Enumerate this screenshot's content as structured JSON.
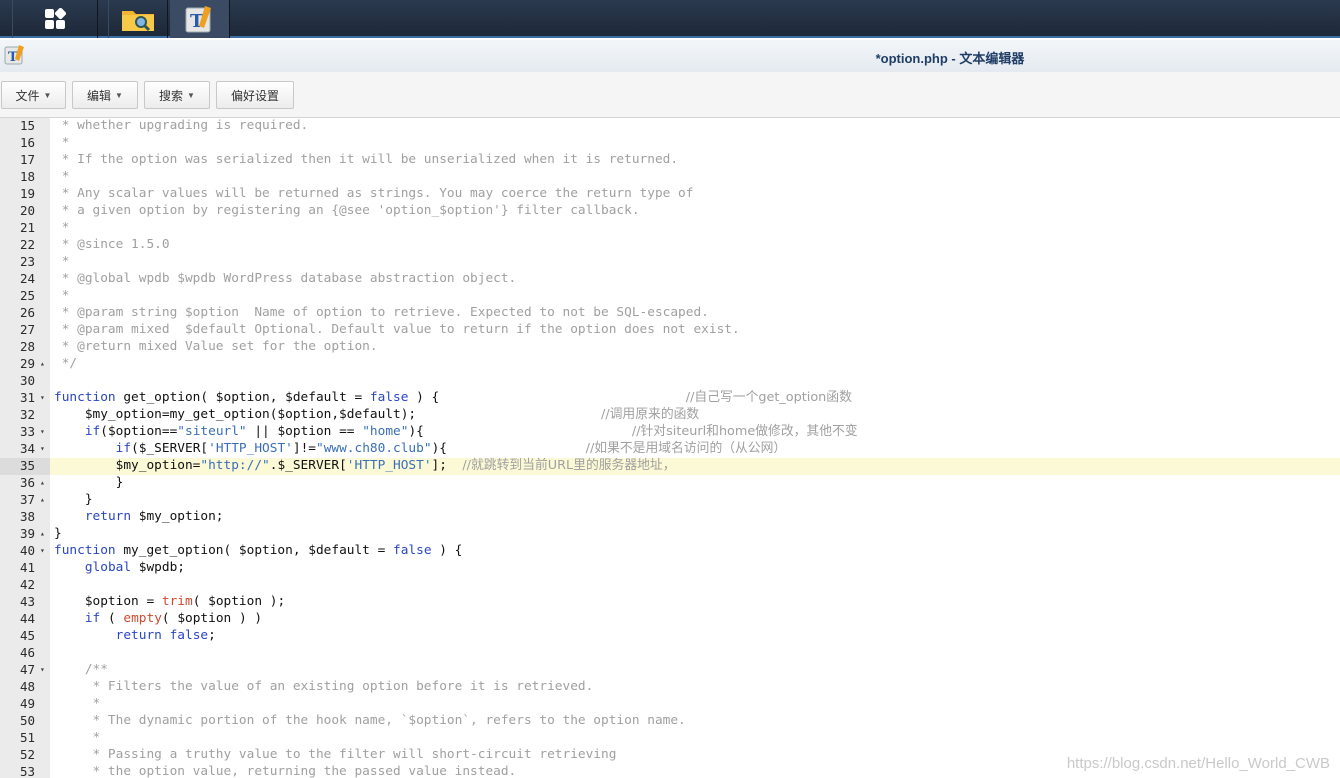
{
  "window": {
    "title": "*option.php - 文本编辑器"
  },
  "taskbar": {
    "icons": [
      "apps-grid-icon",
      "file-station-icon",
      "text-editor-icon"
    ]
  },
  "menu": {
    "file": "文件",
    "edit": "编辑",
    "search": "搜索",
    "preferences": "偏好设置"
  },
  "watermark": "https://blog.csdn.net/Hello_World_CWB",
  "colors": {
    "comment": "#a0a0a0",
    "keyword": "#2a46c4",
    "string": "#3a6fb8",
    "builtin": "#d1492f",
    "active_line": "#fbf9d6"
  },
  "editor": {
    "active_line": 35,
    "lines": [
      {
        "n": "15",
        "f": "",
        "tokens": [
          [
            " * whether upgrading is required.",
            "c"
          ]
        ]
      },
      {
        "n": "16",
        "f": "",
        "tokens": [
          [
            " *",
            "c"
          ]
        ]
      },
      {
        "n": "17",
        "f": "",
        "tokens": [
          [
            " * If the option was serialized then it will be unserialized when it is returned.",
            "c"
          ]
        ]
      },
      {
        "n": "18",
        "f": "",
        "tokens": [
          [
            " *",
            "c"
          ]
        ]
      },
      {
        "n": "19",
        "f": "",
        "tokens": [
          [
            " * Any scalar values will be returned as strings. You may coerce the return type of",
            "c"
          ]
        ]
      },
      {
        "n": "20",
        "f": "",
        "tokens": [
          [
            " * a given option by registering an {@see 'option_$option'} filter callback.",
            "c"
          ]
        ]
      },
      {
        "n": "21",
        "f": "",
        "tokens": [
          [
            " *",
            "c"
          ]
        ]
      },
      {
        "n": "22",
        "f": "",
        "tokens": [
          [
            " * @since 1.5.0",
            "c"
          ]
        ]
      },
      {
        "n": "23",
        "f": "",
        "tokens": [
          [
            " *",
            "c"
          ]
        ]
      },
      {
        "n": "24",
        "f": "",
        "tokens": [
          [
            " * @global wpdb $wpdb WordPress database abstraction object.",
            "c"
          ]
        ]
      },
      {
        "n": "25",
        "f": "",
        "tokens": [
          [
            " *",
            "c"
          ]
        ]
      },
      {
        "n": "26",
        "f": "",
        "tokens": [
          [
            " * @param string $option  Name of option to retrieve. Expected to not be SQL-escaped.",
            "c"
          ]
        ]
      },
      {
        "n": "27",
        "f": "",
        "tokens": [
          [
            " * @param mixed  $default Optional. Default value to return if the option does not exist.",
            "c"
          ]
        ]
      },
      {
        "n": "28",
        "f": "",
        "tokens": [
          [
            " * @return mixed Value set for the option.",
            "c"
          ]
        ]
      },
      {
        "n": "29",
        "f": "▴",
        "tokens": [
          [
            " */",
            "c"
          ]
        ]
      },
      {
        "n": "30",
        "f": "",
        "tokens": []
      },
      {
        "n": "31",
        "f": "▾",
        "tokens": [
          [
            "function",
            "k"
          ],
          [
            " get_option( $option, $default = ",
            "p"
          ],
          [
            "false",
            "k"
          ],
          [
            " ) {                                ",
            "p"
          ],
          [
            "//自己写一个get_option函数",
            "cz"
          ]
        ]
      },
      {
        "n": "32",
        "f": "",
        "tokens": [
          [
            "    $my_option=my_get_option($option,$default);                        ",
            "p"
          ],
          [
            "//调用原来的函数",
            "cz"
          ]
        ]
      },
      {
        "n": "33",
        "f": "▾",
        "tokens": [
          [
            "    ",
            "p"
          ],
          [
            "if",
            "k"
          ],
          [
            "($option==",
            "p"
          ],
          [
            "\"siteurl\"",
            "s"
          ],
          [
            " || $option == ",
            "p"
          ],
          [
            "\"home\"",
            "s"
          ],
          [
            "){                           ",
            "p"
          ],
          [
            "//针对siteurl和home做修改，其他不变",
            "cz"
          ]
        ]
      },
      {
        "n": "34",
        "f": "▾",
        "tokens": [
          [
            "        ",
            "p"
          ],
          [
            "if",
            "k"
          ],
          [
            "($_SERVER[",
            "p"
          ],
          [
            "'HTTP_HOST'",
            "s"
          ],
          [
            "]!=",
            "p"
          ],
          [
            "\"www.ch80.club\"",
            "s"
          ],
          [
            "){                  ",
            "p"
          ],
          [
            "//如果不是用域名访问的（从公网）",
            "cz"
          ]
        ]
      },
      {
        "n": "35",
        "f": "",
        "tokens": [
          [
            "        $my_option=",
            "p"
          ],
          [
            "\"http://\"",
            "s"
          ],
          [
            ".$_SERVER[",
            "p"
          ],
          [
            "'HTTP_HOST'",
            "s"
          ],
          [
            "];  ",
            "p"
          ],
          [
            "//就跳转到当前URL里的服务器地址，",
            "cz"
          ]
        ]
      },
      {
        "n": "36",
        "f": "▴",
        "tokens": [
          [
            "        }",
            "p"
          ]
        ]
      },
      {
        "n": "37",
        "f": "▴",
        "tokens": [
          [
            "    }",
            "p"
          ]
        ]
      },
      {
        "n": "38",
        "f": "",
        "tokens": [
          [
            "    ",
            "p"
          ],
          [
            "return",
            "k"
          ],
          [
            " $my_option;",
            "p"
          ]
        ]
      },
      {
        "n": "39",
        "f": "▴",
        "tokens": [
          [
            "}",
            "p"
          ]
        ]
      },
      {
        "n": "40",
        "f": "▾",
        "tokens": [
          [
            "function",
            "k"
          ],
          [
            " my_get_option( $option, $default = ",
            "p"
          ],
          [
            "false",
            "k"
          ],
          [
            " ) {",
            "p"
          ]
        ]
      },
      {
        "n": "41",
        "f": "",
        "tokens": [
          [
            "    ",
            "p"
          ],
          [
            "global",
            "k"
          ],
          [
            " $wpdb;",
            "p"
          ]
        ]
      },
      {
        "n": "42",
        "f": "",
        "tokens": []
      },
      {
        "n": "43",
        "f": "",
        "tokens": [
          [
            "    $option = ",
            "p"
          ],
          [
            "trim",
            "b"
          ],
          [
            "( $option );",
            "p"
          ]
        ]
      },
      {
        "n": "44",
        "f": "",
        "tokens": [
          [
            "    ",
            "p"
          ],
          [
            "if",
            "k"
          ],
          [
            " ( ",
            "p"
          ],
          [
            "empty",
            "b"
          ],
          [
            "( $option ) )",
            "p"
          ]
        ]
      },
      {
        "n": "45",
        "f": "",
        "tokens": [
          [
            "        ",
            "p"
          ],
          [
            "return",
            "k"
          ],
          [
            " ",
            "p"
          ],
          [
            "false",
            "k"
          ],
          [
            ";",
            "p"
          ]
        ]
      },
      {
        "n": "46",
        "f": "",
        "tokens": []
      },
      {
        "n": "47",
        "f": "▾",
        "tokens": [
          [
            "    /**",
            "c"
          ]
        ]
      },
      {
        "n": "48",
        "f": "",
        "tokens": [
          [
            "     * Filters the value of an existing option before it is retrieved.",
            "c"
          ]
        ]
      },
      {
        "n": "49",
        "f": "",
        "tokens": [
          [
            "     *",
            "c"
          ]
        ]
      },
      {
        "n": "50",
        "f": "",
        "tokens": [
          [
            "     * The dynamic portion of the hook name, `$option`, refers to the option name.",
            "c"
          ]
        ]
      },
      {
        "n": "51",
        "f": "",
        "tokens": [
          [
            "     *",
            "c"
          ]
        ]
      },
      {
        "n": "52",
        "f": "",
        "tokens": [
          [
            "     * Passing a truthy value to the filter will short-circuit retrieving",
            "c"
          ]
        ]
      },
      {
        "n": "53",
        "f": "",
        "tokens": [
          [
            "     * the option value, returning the passed value instead.",
            "c"
          ]
        ]
      }
    ]
  }
}
